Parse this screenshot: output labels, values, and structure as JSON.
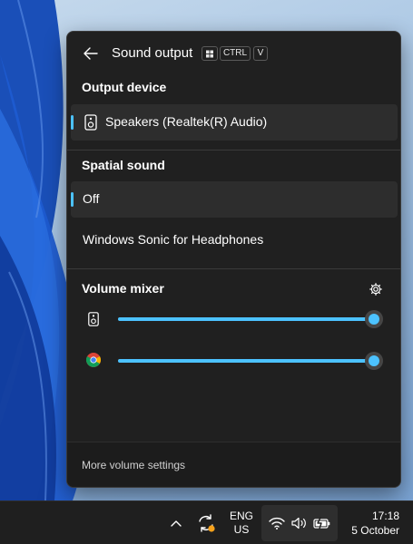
{
  "panel": {
    "title": "Sound output",
    "shortcut_keys": [
      "CTRL",
      "V"
    ],
    "output_device": {
      "label": "Output device",
      "items": [
        {
          "label": "Speakers (Realtek(R) Audio)",
          "icon": "speaker-icon",
          "selected": true
        }
      ]
    },
    "spatial_sound": {
      "label": "Spatial sound",
      "items": [
        {
          "label": "Off",
          "selected": true
        },
        {
          "label": "Windows Sonic for Headphones",
          "selected": false
        }
      ]
    },
    "volume_mixer": {
      "label": "Volume mixer",
      "settings_icon": "gear-icon",
      "apps": [
        {
          "icon": "speaker-icon",
          "level": 1.0
        },
        {
          "icon": "chrome-icon",
          "level": 1.0
        }
      ]
    },
    "footer_link": "More volume settings"
  },
  "taskbar": {
    "language": {
      "line1": "ENG",
      "line2": "US"
    },
    "clock": {
      "time": "17:18",
      "date": "5 October"
    },
    "icons": [
      "chevron-up-icon",
      "sync-icon",
      "wifi-icon",
      "volume-icon",
      "battery-icon"
    ]
  },
  "colors": {
    "accent": "#4cc2ff",
    "panel_bg": "#202020",
    "selected_row_bg": "#2d2d2d",
    "taskbar_bg": "#1f1f1f",
    "update_badge": "#f7a21b"
  }
}
